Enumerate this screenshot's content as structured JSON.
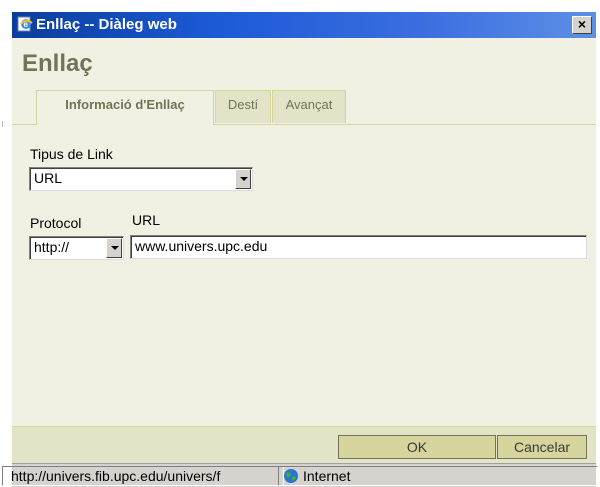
{
  "window": {
    "title": "Enllaç -- Diàleg web",
    "close_label": "×"
  },
  "dialog": {
    "heading": "Enllaç",
    "tabs": [
      {
        "label": "Informació d'Enllaç",
        "active": true
      },
      {
        "label": "Destí",
        "active": false
      },
      {
        "label": "Avançat",
        "active": false
      }
    ],
    "link_type": {
      "label": "Tipus de Link",
      "selected": "URL"
    },
    "protocol": {
      "label": "Protocol",
      "selected": "http://"
    },
    "url": {
      "label": "URL",
      "value": "www.univers.upc.edu"
    },
    "buttons": {
      "ok": "OK",
      "cancel": "Cancelar"
    }
  },
  "statusbar": {
    "url_text": "http://univers.fib.upc.edu/univers/f",
    "zone_text": "Internet",
    "zone_icon": "globe-icon"
  },
  "colors": {
    "titlebar": "#1c5ad6",
    "dialog_background": "#f1f1e3",
    "tab_text": "#737357",
    "button_background": "#d5d59d"
  }
}
